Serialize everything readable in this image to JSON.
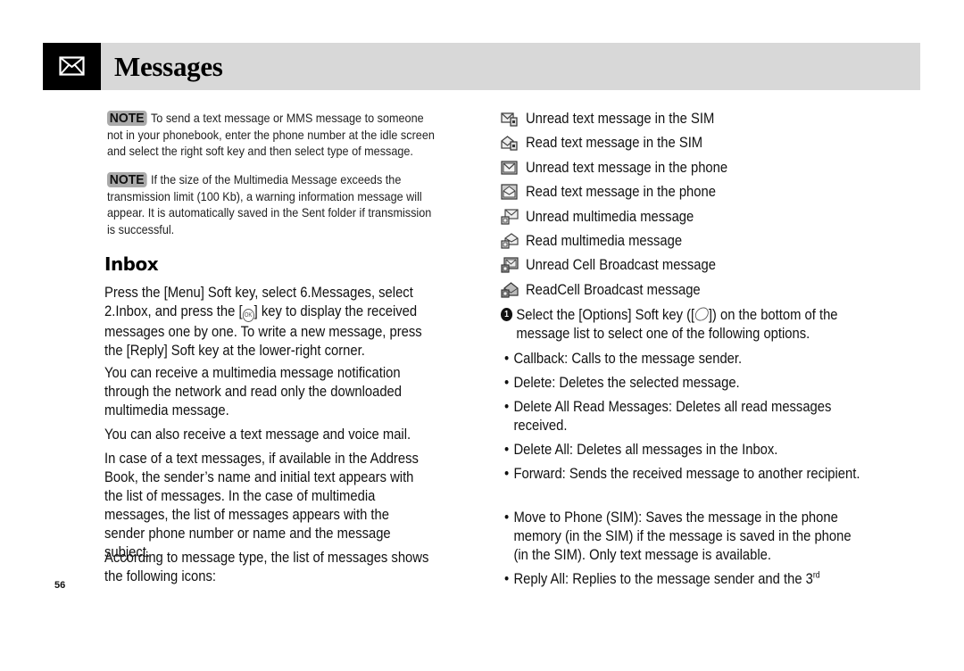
{
  "header": {
    "title": "Messages",
    "icon": "envelope-icon"
  },
  "notes": [
    {
      "badge": "NOTE",
      "text": "To send a text message or MMS message to someone not in your phonebook, enter the phone number at the idle screen and select the right soft key and then select type of message."
    },
    {
      "badge": "NOTE",
      "text": "If the size of the Multimedia Message exceeds the transmission limit (100 Kb), a warning information message will appear. It is automatically saved in the Sent folder if transmission is successful."
    }
  ],
  "inbox": {
    "title": "Inbox",
    "p1_before": "Press the [Menu] Soft key, select 6.Messages, select 2.Inbox, and press the [",
    "p1_key": "OK",
    "p1_after": "] key to display the received messages one by one. To write a new message, press the [Reply] Soft key at the lower-right corner.",
    "p2": "You can receive a multimedia message notification through the network and read only the downloaded multimedia message.",
    "p3": "You can also receive a text message and voice mail.",
    "p4": "In case of a text messages, if available in the Address Book, the sender’s name and initial text appears with the list of messages. In the case of multimedia messages, the list of messages appears with the sender phone number or name and the message subject.",
    "p5": "According to message type, the list of messages shows the following icons:"
  },
  "icon_legend": [
    {
      "icon": "unread-sim-message-icon",
      "label": "Unread text message in the SIM"
    },
    {
      "icon": "read-sim-message-icon",
      "label": "Read text message in the SIM"
    },
    {
      "icon": "unread-phone-message-icon",
      "label": "Unread text message in the phone"
    },
    {
      "icon": "read-phone-message-icon",
      "label": "Read text message in the phone"
    },
    {
      "icon": "unread-multimedia-message-icon",
      "label": "Unread multimedia message"
    },
    {
      "icon": "read-multimedia-message-icon",
      "label": "Read multimedia message"
    },
    {
      "icon": "unread-cell-broadcast-icon",
      "label": "Unread Cell Broadcast message"
    },
    {
      "icon": "read-cell-broadcast-icon",
      "label": "ReadCell Broadcast message"
    }
  ],
  "step": {
    "number": "1",
    "before": "Select the [Options] Soft key ([",
    "after": "]) on the bottom of the message list to select one of the following options."
  },
  "options": [
    {
      "bullet": "•",
      "text": "Callback: Calls to the message sender."
    },
    {
      "bullet": "•",
      "text": "Delete: Deletes the selected message."
    },
    {
      "bullet": "•",
      "text": "Delete All Read Messages: Deletes all read messages received."
    },
    {
      "bullet": "•",
      "text": "Delete All: Deletes all messages in the Inbox."
    },
    {
      "bullet": "•",
      "text": "Forward: Sends the received message to another recipient."
    },
    {
      "bullet": "•",
      "text": "Move to Phone (SIM): Saves the message in the phone memory (in the SIM) if the message is saved in the phone (in the SIM). Only text message is available."
    },
    {
      "bullet": "•",
      "text": "Reply All: Replies to the message sender and the 3",
      "sup": "rd"
    }
  ],
  "page_number": "56"
}
